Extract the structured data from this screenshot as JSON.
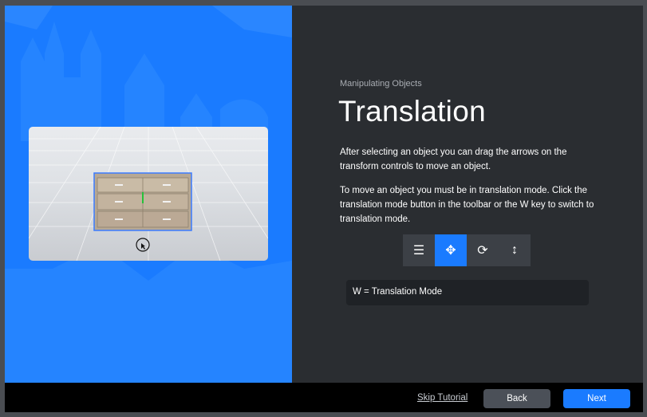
{
  "colors": {
    "accent": "#1a7bff",
    "panel_dark": "#2a2d31",
    "footer": "#000000",
    "back_button": "#4b5058"
  },
  "tutorial": {
    "section": "Manipulating Objects",
    "title": "Translation",
    "paragraph_1": "After selecting an object you can drag the arrows on the transform controls to move an object.",
    "paragraph_2": "To move an object you must be in translation mode. Click the translation mode button in the toolbar or the W key to switch to translation mode.",
    "key_hint": "W = Translation Mode"
  },
  "toolbar": {
    "items": [
      {
        "icon": "menu-icon",
        "glyph": "☰",
        "active": false
      },
      {
        "icon": "move-icon",
        "glyph": "✥",
        "active": true
      },
      {
        "icon": "rotate-icon",
        "glyph": "⟳",
        "active": false
      },
      {
        "icon": "scale-icon",
        "glyph": "↕",
        "active": false
      }
    ]
  },
  "footer": {
    "skip_label": "Skip Tutorial",
    "back_label": "Back",
    "next_label": "Next"
  }
}
